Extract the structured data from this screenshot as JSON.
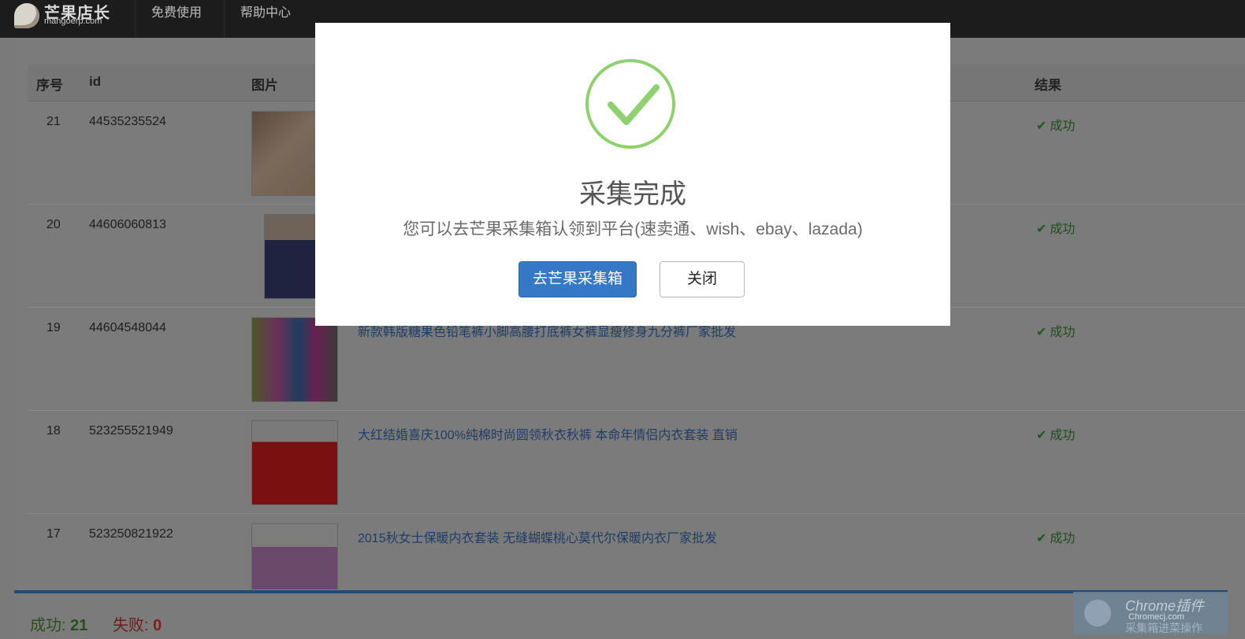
{
  "brand": {
    "name": "芒果店长",
    "domain": "mangoerp.com"
  },
  "nav": [
    {
      "label": "免费使用"
    },
    {
      "label": "帮助中心"
    }
  ],
  "table": {
    "headers": [
      "序号",
      "id",
      "图片",
      "结果"
    ],
    "rows": [
      {
        "no": "21",
        "id": "44535235524",
        "title": "",
        "result": "成功"
      },
      {
        "no": "20",
        "id": "44606060813",
        "title": "",
        "result": "成功"
      },
      {
        "no": "19",
        "id": "44604548044",
        "title": "新款韩版糖果色铅笔裤小脚高腰打底裤女裤显瘦修身九分裤厂家批发",
        "result": "成功"
      },
      {
        "no": "18",
        "id": "523255521949",
        "title": "大红结婚喜庆100%纯棉时尚圆领秋衣秋裤 本命年情侣内衣套装 直销",
        "result": "成功"
      },
      {
        "no": "17",
        "id": "523250821922",
        "title": "2015秋女士保暖内衣套装 无缝蝴蝶桃心莫代尔保暖内衣厂家批发",
        "result": "成功"
      }
    ]
  },
  "footer": {
    "success_label": "成功:",
    "success_value": "21",
    "fail_label": "失败:",
    "fail_value": "0"
  },
  "modal": {
    "title": "采集完成",
    "description": "您可以去芒果采集箱认领到平台(速卖通、wish、ebay、lazada)",
    "primary_button": "去芒果采集箱",
    "close_button": "关闭"
  },
  "watermark": {
    "line1": "Chrome插件",
    "line2": "Chromecj.com",
    "line3": "采集箱进菜操作"
  },
  "colors": {
    "accent": "#3478c6",
    "success_ring": "#8fd16f",
    "topbar": "#1c1c1c"
  },
  "icons": {
    "modal": "check-circle-icon",
    "result": "check-icon"
  }
}
